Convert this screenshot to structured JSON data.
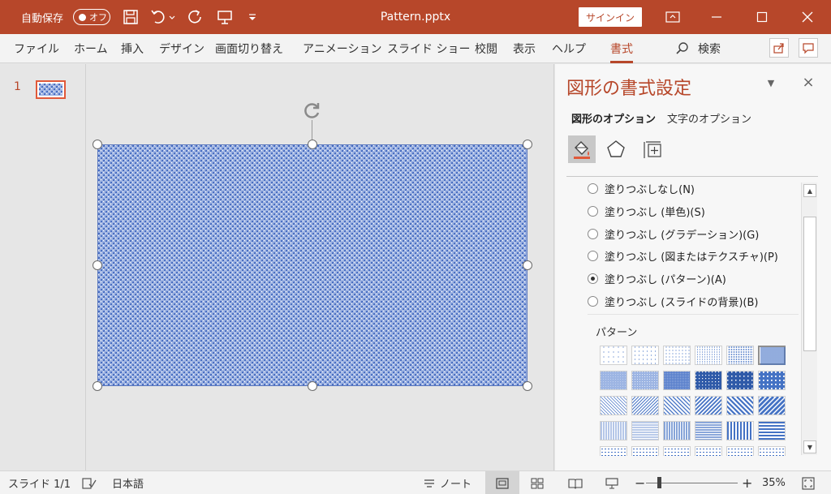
{
  "titlebar": {
    "autosave_label": "自動保存",
    "autosave_state": "オフ",
    "doc_title": "Pattern.pptx",
    "signin_label": "サインイン"
  },
  "tabs": [
    {
      "label": "ファイル"
    },
    {
      "label": "ホーム"
    },
    {
      "label": "挿入"
    },
    {
      "label": "デザイン"
    },
    {
      "label": "画面切り替え"
    },
    {
      "label": "アニメーション"
    },
    {
      "label": "スライド ショー"
    },
    {
      "label": "校閲"
    },
    {
      "label": "表示"
    },
    {
      "label": "ヘルプ"
    },
    {
      "label": "書式"
    },
    {
      "label": "検索"
    }
  ],
  "slides": {
    "number": "1"
  },
  "pane": {
    "title": "図形の書式設定",
    "tab_shape": "図形のオプション",
    "tab_text": "文字のオプション",
    "fill_options": [
      {
        "label": "塗りつぶしなし(N)",
        "selected": false
      },
      {
        "label": "塗りつぶし (単色)(S)",
        "selected": false
      },
      {
        "label": "塗りつぶし (グラデーション)(G)",
        "selected": false
      },
      {
        "label": "塗りつぶし (図またはテクスチャ)(P)",
        "selected": false
      },
      {
        "label": "塗りつぶし (パターン)(A)",
        "selected": true
      },
      {
        "label": "塗りつぶし (スライドの背景)(B)",
        "selected": false
      }
    ],
    "pattern_label": "パターン",
    "pattern_selected_index": 5
  },
  "status": {
    "slide_info": "スライド 1/1",
    "language": "日本語",
    "notes_label": "ノート",
    "zoom": "35%"
  },
  "colors": {
    "accent": "#b7472a",
    "pattern_fg": "#4472c4",
    "pattern_bg": "#ffffff"
  }
}
